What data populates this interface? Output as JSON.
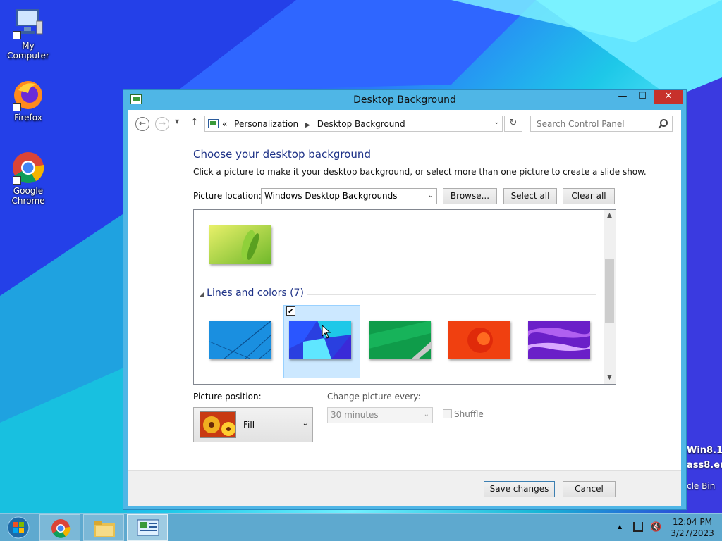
{
  "desktop": {
    "icons": [
      {
        "label": "My Computer"
      },
      {
        "label": "Firefox"
      },
      {
        "label_line1": "Google",
        "label_line2": "Chrome"
      }
    ],
    "edge_text": [
      "Win8.1",
      "ass8.eu",
      "cle Bin"
    ]
  },
  "window": {
    "title": "Desktop Background",
    "controls": {
      "minimize": "—",
      "maximize": "☐",
      "close": "✕"
    }
  },
  "address": {
    "back": "←",
    "forward": "→",
    "up": "↑",
    "overflow": "«",
    "path": [
      "Personalization",
      "Desktop Background"
    ],
    "refresh": "↻",
    "search_placeholder": "Search Control Panel"
  },
  "content": {
    "heading": "Choose your desktop background",
    "description": "Click a picture to make it your desktop background, or select more than one picture to create a slide show.",
    "picture_location_label": "Picture location:",
    "picture_location_value": "Windows Desktop Backgrounds",
    "browse": "Browse...",
    "select_all": "Select all",
    "clear_all": "Clear all",
    "group_name": "Lines and colors (7)",
    "group_collapse": "◢",
    "selected_check": "✔"
  },
  "options": {
    "position_label": "Picture position:",
    "position_value": "Fill",
    "change_label": "Change picture every:",
    "change_value": "30 minutes",
    "shuffle": "Shuffle"
  },
  "footer": {
    "save": "Save changes",
    "cancel": "Cancel"
  },
  "taskbar": {
    "time": "12:04 PM",
    "date": "3/27/2023"
  },
  "glyphs": {
    "caret": "⌄",
    "sb_up": "▲",
    "sb_down": "▼",
    "tray_arrow": "▲",
    "volume": "🔇"
  }
}
